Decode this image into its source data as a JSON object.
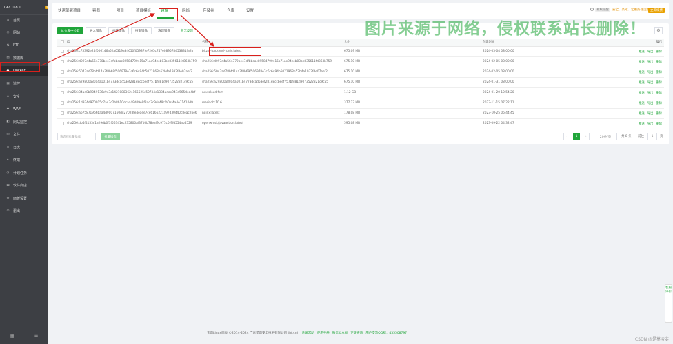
{
  "sidebar": {
    "ip": "192.168.1.1",
    "badge": "0",
    "items": [
      {
        "label": "首页",
        "icon": "home-icon",
        "glyph": "⌂"
      },
      {
        "label": "网站",
        "icon": "globe-icon",
        "glyph": "◎"
      },
      {
        "label": "FTP",
        "icon": "ftp-icon",
        "glyph": "⇅"
      },
      {
        "label": "数据库",
        "icon": "database-icon",
        "glyph": "▤"
      },
      {
        "label": "Docker",
        "icon": "docker-icon",
        "glyph": "●"
      },
      {
        "label": "监控",
        "icon": "monitor-icon",
        "glyph": "▣"
      },
      {
        "label": "安全",
        "icon": "shield-icon",
        "glyph": "◈"
      },
      {
        "label": "WAF",
        "icon": "waf-icon",
        "glyph": "◆"
      },
      {
        "label": "网站监控",
        "icon": "chart-icon",
        "glyph": "◧"
      },
      {
        "label": "文件",
        "icon": "folder-icon",
        "glyph": "▭"
      },
      {
        "label": "日志",
        "icon": "log-icon",
        "glyph": "≡"
      },
      {
        "label": "终端",
        "icon": "terminal-icon",
        "glyph": "▸"
      },
      {
        "label": "计划任务",
        "icon": "clock-icon",
        "glyph": "◷"
      },
      {
        "label": "软件商店",
        "icon": "store-icon",
        "glyph": "▦"
      },
      {
        "label": "面板设置",
        "icon": "settings-icon",
        "glyph": "⚙"
      },
      {
        "label": "退出",
        "icon": "logout-icon",
        "glyph": "⏻"
      }
    ]
  },
  "tabs": [
    {
      "label": "快速部署项目"
    },
    {
      "label": "容器"
    },
    {
      "label": "项目"
    },
    {
      "label": "项目模板"
    },
    {
      "label": "镜像"
    },
    {
      "label": "网络"
    },
    {
      "label": "存储卷"
    },
    {
      "label": "仓库"
    },
    {
      "label": "设置"
    }
  ],
  "notice": {
    "tag": "系统提醒",
    "text": "安全、高效、让服务器运维更简单",
    "pay": "立即续费"
  },
  "toolbar": {
    "pull": "从仓库中拉取",
    "import": "导入镜像",
    "build": "构建镜像",
    "search": "搜索镜像",
    "clean": "清理镜像",
    "more": "暂无反馈"
  },
  "watermark": "图片来源于网络，侵权联系站长删除！",
  "table": {
    "headers": [
      "ID",
      "名称",
      "大小",
      "创建时间",
      "操作"
    ],
    "actions": [
      "推送",
      "导出",
      "删除"
    ],
    "rows": [
      {
        "id": "sha256:c75392e25f006146a62a0319a34650f05987fe7265c747e089578453831fa2b",
        "name": "bitzer-backend-runjs:latest",
        "size": "675.09 MB",
        "time": "2024-03-04 08:00:00"
      },
      {
        "id": "sha256:d097d4a564370be47dfbbeac89584790415a71ae94ceb03be835611fd863b759",
        "name": "sha256:d097d4a564370be47dfbbeac89584790415a71ae94ceb03be835611fd863b759",
        "size": "675.10 MB",
        "time": "2024-02-05 08:00:00"
      },
      {
        "id": "sha256:5043ad78bfd14a3f0b69f506978e7c6c6494b5071968b52b4a1932fde07aef2",
        "name": "sha256:5043ad78bfd14a3f0b69f506978e7c6c6494b5071968b52b4a1932fde07aef2",
        "size": "675.10 MB",
        "time": "2024-02-05 08:00:00"
      },
      {
        "id": "sha256:a29800a80a4a101b4773dcad53ef281e8ccbeef757bfd81d9073522821c9c55",
        "name": "sha256:a29800a80a4a101b4773dcad53ef281e8ccbeef757bfd81d9073522821c9c55",
        "size": "675.10 MB",
        "time": "2024-01-31 08:00:00"
      },
      {
        "id": "sha256:34ad8b9049136c9e3c14210883624165525c50734e1334adae947a565dea4bf",
        "name": "nextcloud:fpm",
        "size": "1.12 GB",
        "time": "2024-01-20 10:54:20"
      },
      {
        "id": "sha256:1d924d970915c7a43c2b8b10dcaa49d09e9f2dd3c9dc49cfb0ef4a4e71410d9",
        "name": "mariadb:10.6",
        "size": "377.23 MB",
        "time": "2023-11-15 07:22:11"
      },
      {
        "id": "sha256:a6758719b6baa4d9007160dd27028fe4eaee7ce6166221a97d30440c8eac2be6",
        "name": "nginx:latest",
        "size": "178.08 MB",
        "time": "2023-10-25 06:44:45"
      },
      {
        "id": "sha256:db5f4153c1a29db0f3f56341ec235800af37d0b78eaf9c971c0f9fd554ab5529",
        "name": "openwhisk/javaaction:latest",
        "size": "595.08 MB",
        "time": "2023-09-22 04:32:47"
      }
    ]
  },
  "footer_bar": {
    "batch_placeholder": "请选择批量操作",
    "batch_button": "批量操作",
    "page_current": "1",
    "per_page": "20条/页",
    "total": "共 8 条",
    "goto_label": "前往",
    "goto_value": "1",
    "page_unit": "页"
  },
  "footer": {
    "copyright": "宝塔Linux面板 ©2014-2024 广东堡塔安全技术有限公司 (bt.cn)",
    "links": [
      "论坛求助",
      "使用手册",
      "微信公众号",
      "正版查询",
      "用户交流QQ群：435508797"
    ]
  },
  "float_panel": "客服 评价",
  "csdn": "CSDN @是莫凌斐",
  "colors": {
    "accent": "#20a53a",
    "sidebar": "#3d3f44",
    "highlight": "#d9201c",
    "pay": "#e9a100"
  }
}
